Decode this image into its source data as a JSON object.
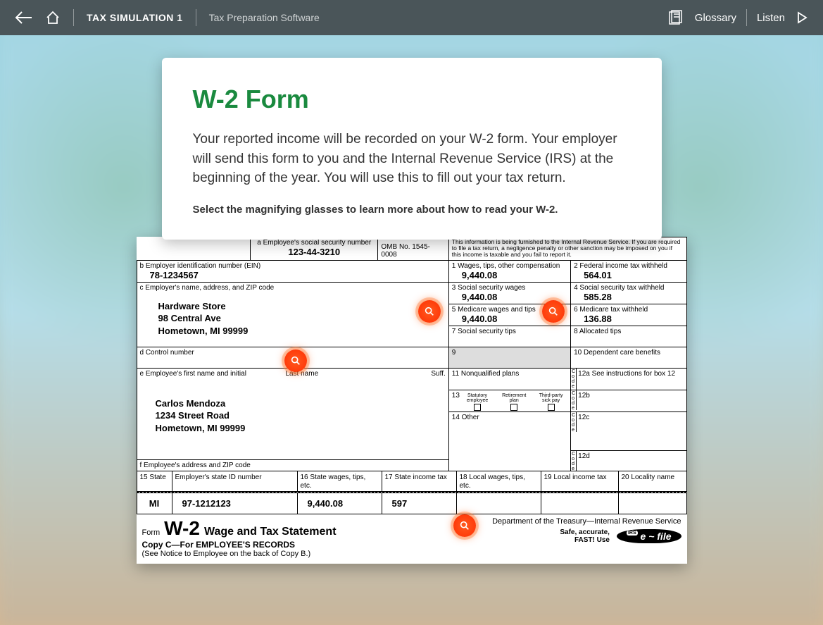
{
  "header": {
    "title": "TAX SIMULATION 1",
    "subtitle": "Tax Preparation Software",
    "glossary": "Glossary",
    "listen": "Listen"
  },
  "card": {
    "heading": "W-2 Form",
    "body": "Your reported income will be recorded on your W-2 form. Your employer will send this form to you and the Internal Revenue Service (IRS) at the beginning of the year. You will use this to fill out your tax return.",
    "instruction": "Select the magnifying glasses to learn more about how to read your W-2."
  },
  "w2": {
    "box_a_label": "a  Employee's social security number",
    "box_a_value": "123-44-3210",
    "omb": "OMB No. 1545-0008",
    "furnish_text": "This information is being furnished to the Internal Revenue Service. If you are required to file a tax return, a negligence penalty or other sanction may be imposed on you if this income is taxable and you fail to report it.",
    "box_b_label": "b  Employer identification number (EIN)",
    "box_b_value": "78-1234567",
    "box_c_label": "c  Employer's name, address, and ZIP code",
    "employer_name": "Hardware Store",
    "employer_addr1": "98 Central Ave",
    "employer_addr2": "Hometown, MI 99999",
    "box1_label": "1   Wages, tips, other compensation",
    "box1_value": "9,440.08",
    "box2_label": "2   Federal income tax withheld",
    "box2_value": "564.01",
    "box3_label": "3   Social security wages",
    "box3_value": "9,440.08",
    "box4_label": "4   Social security tax withheld",
    "box4_value": "585.28",
    "box5_label": "5   Medicare wages and tips",
    "box5_value": "9,440.08",
    "box6_label": "6   Medicare tax withheld",
    "box6_value": "136.88",
    "box7_label": "7   Social security tips",
    "box8_label": "8   Allocated tips",
    "box_d_label": "d  Control number",
    "box9_label": "9",
    "box10_label": "10  Dependent care benefits",
    "box_e_label": "e  Employee's first name and initial",
    "box_e_last": "Last name",
    "box_e_suff": "Suff.",
    "employee_name": "Carlos Mendoza",
    "employee_addr1": "1234 Street Road",
    "employee_addr2": "Hometown, MI 99999",
    "box11_label": "11  Nonqualified plans",
    "box12a_label": "12a  See instructions for box 12",
    "box12b_label": "12b",
    "box12c_label": "12c",
    "box12d_label": "12d",
    "box13_label": "13",
    "box13_stat": "Statutory employee",
    "box13_ret": "Retirement plan",
    "box13_sick": "Third-party sick pay",
    "box14_label": "14  Other",
    "box_f_label": "f  Employee's address and ZIP code",
    "box15_label": "15  State",
    "box15_state": "MI",
    "box15_ein_label": "Employer's state ID number",
    "box15_ein": "97-1212123",
    "box16_label": "16  State wages, tips, etc.",
    "box16_value": "9,440.08",
    "box17_label": "17  State income tax",
    "box17_value": "597",
    "box18_label": "18  Local wages, tips, etc.",
    "box19_label": "19  Local income tax",
    "box20_label": "20  Locality name",
    "form_prefix": "Form",
    "form_code": "W-2",
    "form_title": "Wage and Tax Statement",
    "copy_line": "Copy C—For EMPLOYEE'S RECORDS",
    "notice_line": "(See Notice to Employee on the back of Copy B.)",
    "dept_line": "Department of the Treasury—Internal Revenue Service",
    "safe_line1": "Safe, accurate,",
    "safe_line2": "FAST! Use",
    "efile_irs": "IRS",
    "efile_text": "e ~ file"
  }
}
